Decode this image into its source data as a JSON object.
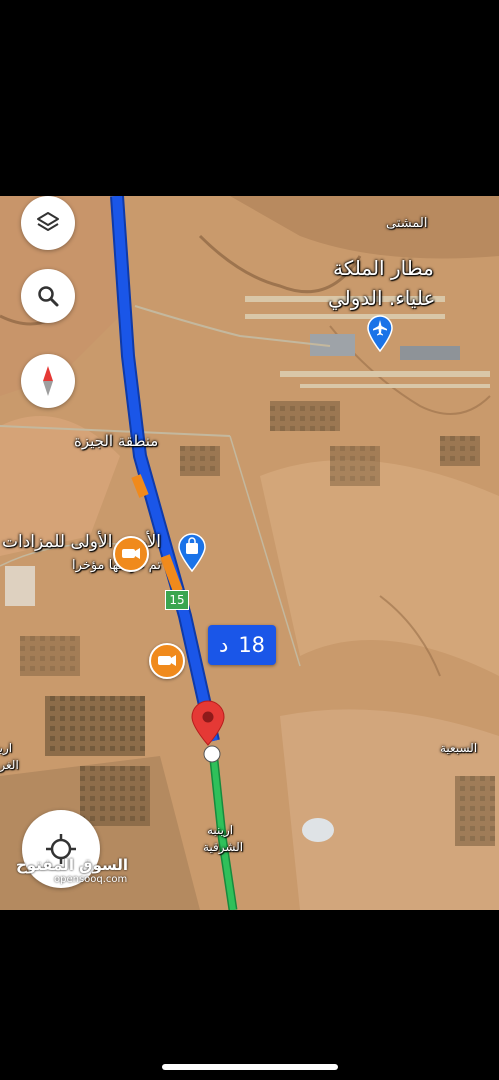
{
  "map": {
    "labels": {
      "mushatta": "المشتى",
      "airport_line1": "مطار الملكة",
      "airport_line2": "علياء. الدولي",
      "giza_region": "منطقة الجيزة",
      "auction_line1": "الأرض الأولى للمزادات",
      "auction_line2": "تم عرضها مؤخرا",
      "sibiya": "السبعية",
      "urainba_line1": "ارينبه",
      "urainba_line2": "الشرقية",
      "left_edge_line1": "ارينبه",
      "left_edge_line2": "الغربية"
    },
    "route": {
      "eta_value": "18",
      "eta_unit": "د",
      "road_number": "15"
    },
    "watermark": {
      "arabic": "السوق المفتوح",
      "latin": "opensooq.com"
    },
    "icons": {
      "layers": "layers-icon",
      "search": "search-icon",
      "compass": "compass-icon",
      "recenter": "recenter-icon",
      "airport": "airplane-icon",
      "shopping": "shopping-bag-icon",
      "speed_camera": "speed-camera-icon",
      "destination": "destination-pin-icon"
    },
    "colors": {
      "route_blue": "#1a56e8",
      "route_green": "#2fc05a",
      "traffic_orange": "#f08a1c",
      "pin_red": "#e53935",
      "desert": "#c99a6c"
    }
  }
}
